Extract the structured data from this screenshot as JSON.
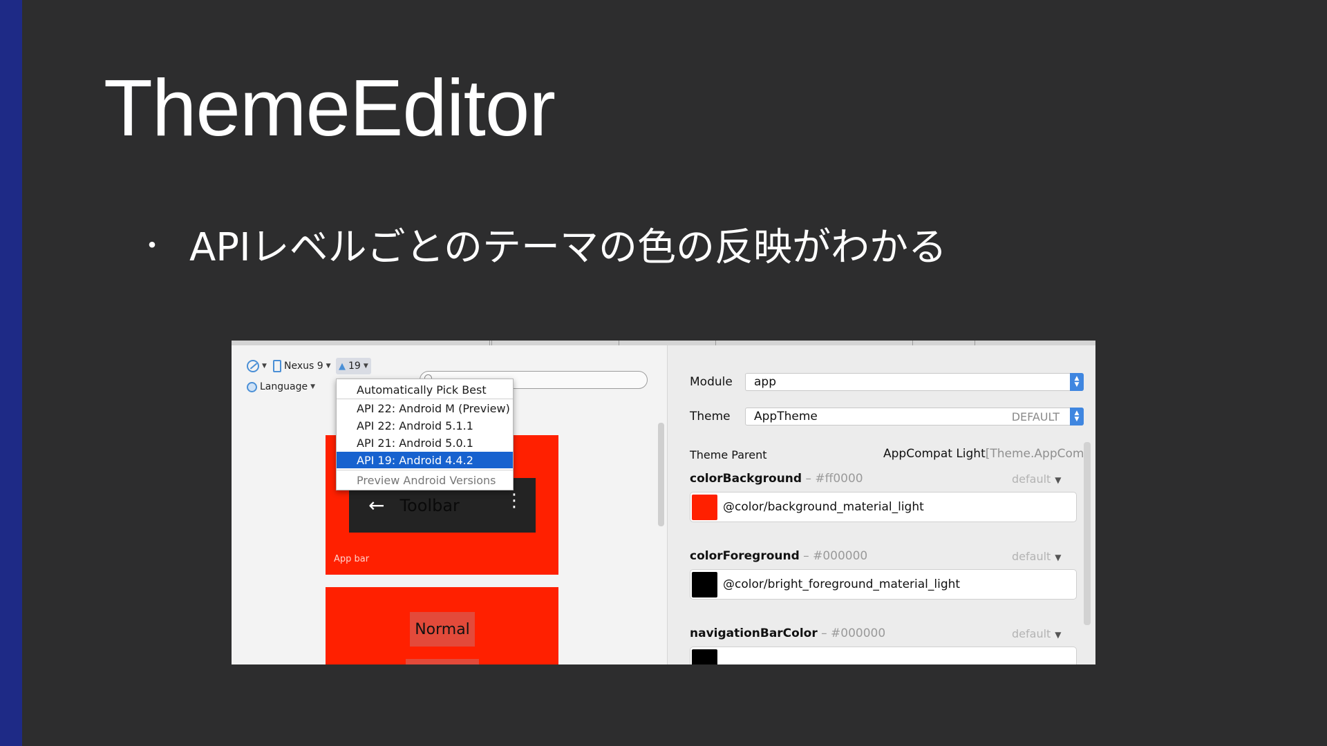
{
  "slide": {
    "title": "ThemeEditor",
    "bullet_mark": "・",
    "bullet_text": "APIレベルごとのテーマの色の反映がわかる"
  },
  "toolbar": {
    "device": "Nexus 9",
    "api_level": "19",
    "language": "Language"
  },
  "api_menu": {
    "items": [
      "Automatically Pick Best",
      "API 22: Android M (Preview)",
      "API 22: Android 5.1.1",
      "API 21: Android 5.0.1",
      "API 19: Android 4.4.2",
      "Preview Android Versions"
    ],
    "selected_index": 4
  },
  "preview": {
    "toolbar_title": "Toolbar",
    "back_glyph": "←",
    "more_glyph": "⋮",
    "appbar_label": "App bar",
    "button_label": "Normal",
    "accent_color": "#ff2000"
  },
  "properties": {
    "module_label": "Module",
    "module_value": "app",
    "theme_label": "Theme",
    "theme_value": "AppTheme",
    "theme_default_tag": "DEFAULT",
    "theme_parent_label": "Theme Parent",
    "theme_parent_value": "AppCompat Light",
    "theme_parent_faded": "[Theme.AppCom",
    "attributes": [
      {
        "name": "colorBackground",
        "hex": " – #ff0000",
        "default": "default",
        "value": "@color/background_material_light",
        "swatch": "#ff2000"
      },
      {
        "name": "colorForeground",
        "hex": " – #000000",
        "default": "default",
        "value": "@color/bright_foreground_material_light",
        "swatch": "#000000"
      },
      {
        "name": "navigationBarColor",
        "hex": " – #000000",
        "default": "default",
        "value": "",
        "swatch": "#000000"
      }
    ]
  },
  "colors": {
    "background": "#2d2d2e",
    "accent_bar": "#1e2a86",
    "selection": "#1762cf"
  }
}
